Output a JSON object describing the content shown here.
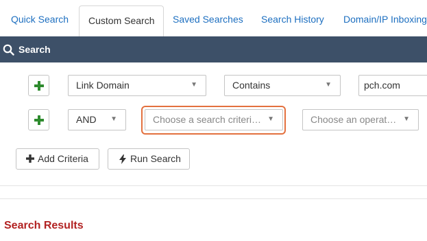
{
  "tabs": [
    {
      "label": "Quick Search",
      "active": false
    },
    {
      "label": "Custom Search",
      "active": true
    },
    {
      "label": "Saved Searches",
      "active": false
    },
    {
      "label": "Search History",
      "active": false
    },
    {
      "label": "Domain/IP Inboxing",
      "active": false
    }
  ],
  "search_header": {
    "title": "Search",
    "icon": "search-icon"
  },
  "criteria_rows": [
    {
      "field": "Link Domain",
      "operator": "Contains",
      "value": "pch.com"
    },
    {
      "conjunction": "AND",
      "field_placeholder": "Choose a search criteri…",
      "operator_placeholder": "Choose an operat…"
    }
  ],
  "buttons": {
    "add_criteria": "Add Criteria",
    "run_search": "Run Search"
  },
  "results": {
    "title": "Search Results"
  },
  "colors": {
    "tab_link": "#1d6fc0",
    "header_bg": "#3d5068",
    "focus_ring": "#e3703e",
    "plus_green": "#2e8b2e",
    "results_title": "#b22222"
  }
}
